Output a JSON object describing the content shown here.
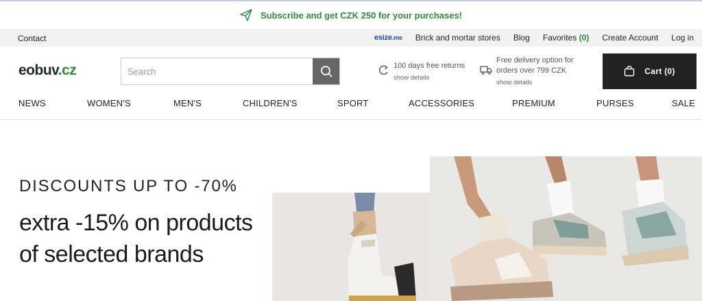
{
  "promo": {
    "text": "Subscribe and get CZK 250 for your purchases!",
    "icon": "paper-plane-icon",
    "color": "#2e8b3a"
  },
  "utility": {
    "contact": "Contact",
    "esize": "esize",
    "esize_suffix": ".me",
    "links": {
      "stores": "Brick and mortar stores",
      "blog": "Blog",
      "favorites": "Favorites",
      "favorites_count": "(0)",
      "create_account": "Create Account",
      "login": "Log in"
    }
  },
  "header": {
    "logo_main": "eobuv",
    "logo_tld": ".cz",
    "search": {
      "placeholder": "Search",
      "icon": "search-icon"
    },
    "perks": {
      "returns": {
        "title": "100 days free returns",
        "link": "show details",
        "icon": "return-arrow-icon"
      },
      "delivery": {
        "title": "Free delivery option for orders over 799 CZK",
        "link": "show details",
        "icon": "truck-icon"
      }
    },
    "cart": {
      "label": "Cart",
      "count": "(0)",
      "icon": "bag-icon"
    }
  },
  "nav": {
    "items": [
      "NEWS",
      "WOMEN'S",
      "MEN'S",
      "CHILDREN'S",
      "SPORT",
      "ACCESSORIES",
      "PREMIUM",
      "PURSES",
      "SALE"
    ]
  },
  "hero": {
    "eyebrow": "DISCOUNTS UP TO -70%",
    "title": "extra -15% on products of selected brands"
  },
  "colors": {
    "accent": "#2e8b3a",
    "dark": "#222222",
    "brand_blue": "#1f4a9b"
  }
}
